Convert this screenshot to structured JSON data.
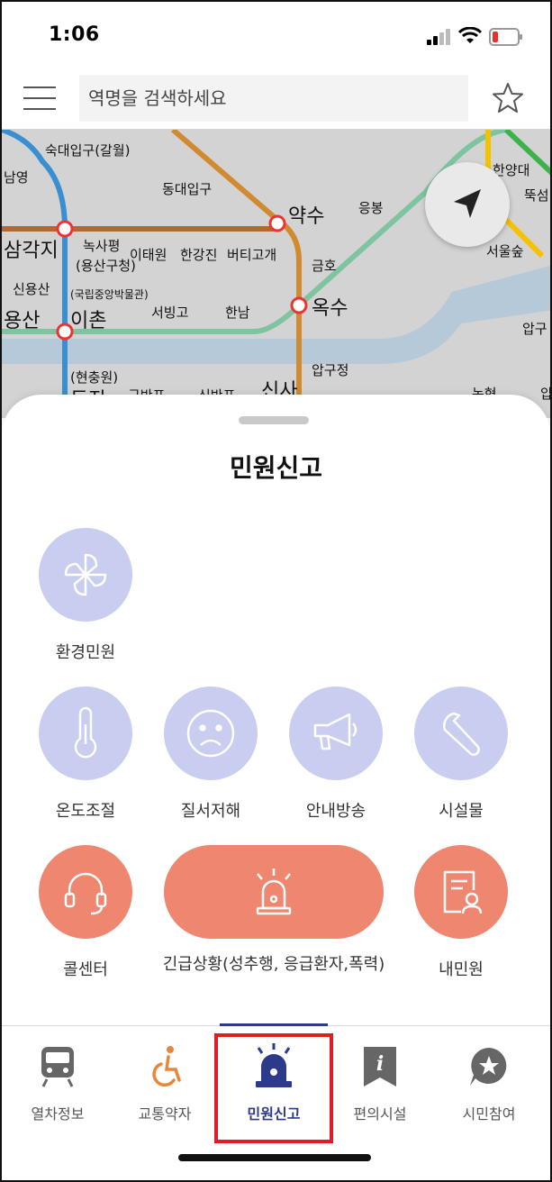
{
  "status": {
    "time": "1:06"
  },
  "search": {
    "placeholder": "역명을 검색하세요"
  },
  "map": {
    "stations": [
      {
        "label": "숙대입구(갈월)"
      },
      {
        "label": "동대입구"
      },
      {
        "label": "약수"
      },
      {
        "label": "응봉"
      },
      {
        "label": "한양대"
      },
      {
        "label": "뚝섬"
      },
      {
        "label": "남영"
      },
      {
        "label": "삼각지"
      },
      {
        "label": "녹사평"
      },
      {
        "label": "(용산구청)"
      },
      {
        "label": "이태원"
      },
      {
        "label": "한강진"
      },
      {
        "label": "버티고개"
      },
      {
        "label": "금호"
      },
      {
        "label": "서울숲"
      },
      {
        "label": "신용산"
      },
      {
        "label": "(국립중앙박물관)"
      },
      {
        "label": "이촌"
      },
      {
        "label": "서빙고"
      },
      {
        "label": "한남"
      },
      {
        "label": "옥수"
      },
      {
        "label": "용산"
      },
      {
        "label": "압구"
      },
      {
        "label": "압구정"
      },
      {
        "label": "(현충원)"
      },
      {
        "label": "동작"
      },
      {
        "label": "구반포"
      },
      {
        "label": "신반포"
      },
      {
        "label": "신사"
      },
      {
        "label": "논현"
      },
      {
        "label": "압구"
      }
    ],
    "line_colors": {
      "line1": "#2a6fb5",
      "line3": "#e07a2e",
      "line4": "#3a8fd0",
      "line6": "#b06a2a",
      "gyeongui": "#7fc4a0",
      "suin": "#f5c200",
      "line2": "#3bb34a"
    }
  },
  "sheet": {
    "title": "민원신고",
    "items": [
      {
        "label": "환경민원",
        "icon": "pinwheel-icon"
      },
      {
        "label": "온도조절",
        "icon": "thermometer-icon"
      },
      {
        "label": "질서저해",
        "icon": "sad-face-icon"
      },
      {
        "label": "안내방송",
        "icon": "megaphone-icon"
      },
      {
        "label": "시설물",
        "icon": "wrench-icon"
      },
      {
        "label": "콜센터",
        "icon": "headset-icon"
      },
      {
        "label": "긴급상황(성추행, 응급환자,폭력)",
        "icon": "siren-icon"
      },
      {
        "label": "내민원",
        "icon": "my-complaint-icon"
      }
    ]
  },
  "nav": {
    "items": [
      {
        "label": "열차정보",
        "icon": "train-icon"
      },
      {
        "label": "교통약자",
        "icon": "wheelchair-icon"
      },
      {
        "label": "민원신고",
        "icon": "siren-icon"
      },
      {
        "label": "편의시설",
        "icon": "info-icon"
      },
      {
        "label": "시민참여",
        "icon": "star-bubble-icon"
      }
    ],
    "active_index": 2
  },
  "colors": {
    "accent": "#2d3a8c",
    "soft_blue": "#c9cdf0",
    "coral": "#ef8670",
    "highlight": "#e11d24"
  }
}
